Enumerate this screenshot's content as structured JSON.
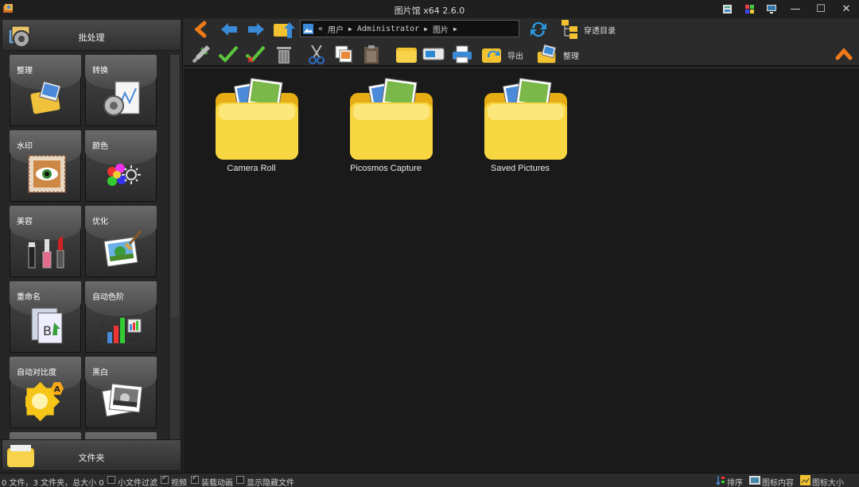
{
  "window": {
    "title": "图片馆 x64 2.6.0"
  },
  "left_panel": {
    "header_label": "批处理",
    "footer_label": "文件夹",
    "tiles": [
      {
        "label": "整理",
        "icon": "organize-icon"
      },
      {
        "label": "转换",
        "icon": "convert-icon"
      },
      {
        "label": "水印",
        "icon": "watermark-icon"
      },
      {
        "label": "颜色",
        "icon": "color-icon"
      },
      {
        "label": "美容",
        "icon": "cosmetics-icon"
      },
      {
        "label": "优化",
        "icon": "optimize-icon"
      },
      {
        "label": "重命名",
        "icon": "rename-icon"
      },
      {
        "label": "自动色阶",
        "icon": "auto-levels-icon"
      },
      {
        "label": "自动对比度",
        "icon": "auto-contrast-icon"
      },
      {
        "label": "黑白",
        "icon": "black-white-icon"
      }
    ]
  },
  "toolbar": {
    "path_prefix": "«",
    "path": [
      "用户",
      "Administrator",
      "图片"
    ],
    "traverse_label": "穿透目录",
    "export_label": "导出",
    "organize_label": "整理"
  },
  "folders": [
    {
      "name": "Camera Roll"
    },
    {
      "name": "Picosmos Capture"
    },
    {
      "name": "Saved Pictures"
    }
  ],
  "status": {
    "summary": "0 文件，3 文件夹，总大小 0",
    "small_file_filter": "小文件过滤",
    "video": "视频",
    "load_animation": "装载动画",
    "show_hidden": "显示隐藏文件",
    "sort": "排序",
    "icon_content": "图标内容",
    "icon_size": "图标大小"
  }
}
